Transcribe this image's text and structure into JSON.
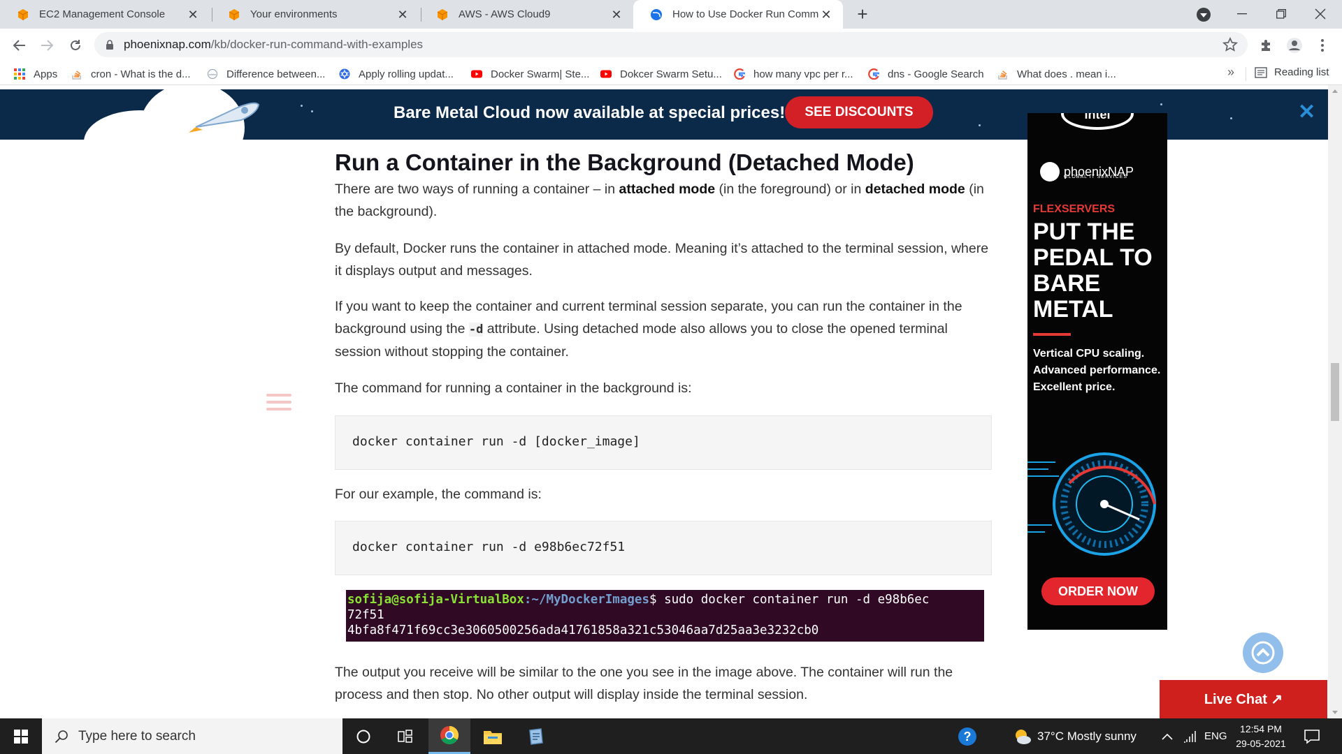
{
  "browser": {
    "tabs": [
      {
        "title": "EC2 Management Console",
        "favicon": "aws-orange-cube-icon",
        "active": false
      },
      {
        "title": "Your environments",
        "favicon": "aws-orange-cube-icon",
        "active": false
      },
      {
        "title": "AWS - AWS Cloud9",
        "favicon": "aws-orange-cube-icon",
        "active": false
      },
      {
        "title": "How to Use Docker Run Comma",
        "favicon": "phoenixnap-globe-icon",
        "active": true
      }
    ],
    "url_host": "phoenixnap.com",
    "url_path": "/kb/docker-run-command-with-examples",
    "bookmarks": [
      {
        "label": "Apps",
        "icon": "apps-grid-icon"
      },
      {
        "label": "cron - What is the d...",
        "icon": "stackoverflow-icon"
      },
      {
        "label": "Difference between...",
        "icon": "site-icon"
      },
      {
        "label": "Apply rolling updat...",
        "icon": "kubernetes-icon"
      },
      {
        "label": "Docker Swarm| Ste...",
        "icon": "youtube-icon"
      },
      {
        "label": "Dokcer Swarm Setu...",
        "icon": "youtube-icon"
      },
      {
        "label": "how many vpc per r...",
        "icon": "google-icon"
      },
      {
        "label": "dns - Google Search",
        "icon": "google-icon"
      },
      {
        "label": "What does . mean i...",
        "icon": "stackoverflow-icon"
      }
    ],
    "bookmarks_more": "»",
    "reading_list": "Reading list"
  },
  "promo": {
    "headline": "Bare Metal Cloud now available at special prices!",
    "cta": "SEE DISCOUNTS",
    "close": "✕"
  },
  "article": {
    "heading": "Run a Container in the Background (Detached Mode)",
    "p1_a": "There are two ways of running a container – in ",
    "p1_b": "attached mode",
    "p1_c": " (in the foreground) or in ",
    "p1_d": "detached mode",
    "p1_e": " (in the background).",
    "p2": "By default, Docker runs the container in attached mode. Meaning it’s attached to the terminal session, where it displays output and messages.",
    "p3_a": "If you want to keep the container and current terminal session separate, you can run the container in the background using the ",
    "p3_code": "-d",
    "p3_b": " attribute. Using detached mode also allows you to close the opened terminal session without stopping the container.",
    "p4": "The command for running a container in the background is:",
    "code1": "docker container run -d [docker_image]",
    "p5": "For our example, the command is:",
    "code2": "docker container run -d e98b6ec72f51",
    "terminal_user": "sofija@sofija-VirtualBox",
    "terminal_path": ":~/MyDockerImages",
    "terminal_cmd_1": "$ sudo docker container run -d e98b6ec",
    "terminal_cmd_2": "72f51",
    "terminal_output": "4bfa8f471f69cc3e3060500256ada41761858a321c53046aa7d25aa3e3232cb0",
    "p6": "The output you receive will be similar to the one you see in the image above. The container will run the process and then stop. No other output will display inside the terminal session."
  },
  "ad": {
    "brand_top": "intel",
    "brand": "phoenixNAP",
    "brand_sub": "GLOBAL IT SERVICES",
    "kicker": "FLEXSERVERS",
    "headline": "PUT THE PEDAL TO BARE METAL",
    "copy_1": "Vertical CPU scaling.",
    "copy_2": "Advanced performance.",
    "copy_3": "Excellent price.",
    "cta": "ORDER NOW"
  },
  "widgets": {
    "live_chat": "Live Chat ↗"
  },
  "taskbar": {
    "search_placeholder": "Type here to search",
    "weather": "37°C  Mostly sunny",
    "language": "ENG",
    "time": "12:54 PM",
    "date": "29-05-2021"
  },
  "colors": {
    "promo_bg": "#0b2a4a",
    "cta_red": "#d32027",
    "terminal_bg": "#300a24",
    "terminal_green": "#8ae234",
    "terminal_blue": "#729fcf"
  }
}
